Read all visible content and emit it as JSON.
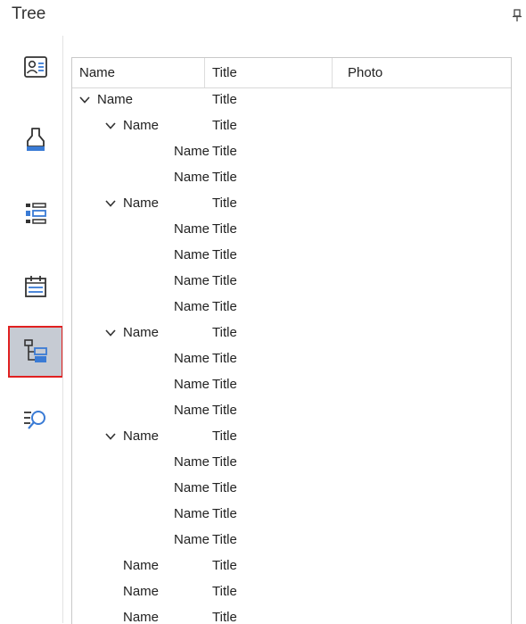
{
  "panel": {
    "title": "Tree"
  },
  "sidebar": {
    "items": [
      {
        "icon": "contact-card-icon",
        "active": false
      },
      {
        "icon": "paint-brush-icon",
        "active": false
      },
      {
        "icon": "list-layout-icon",
        "active": false
      },
      {
        "icon": "calendar-icon",
        "active": false
      },
      {
        "icon": "tree-structure-icon",
        "active": true
      },
      {
        "icon": "search-list-icon",
        "active": false
      }
    ]
  },
  "tree": {
    "columns": [
      "Name",
      "Title",
      "Photo"
    ],
    "rows": [
      {
        "name": "Name",
        "title": "Title",
        "level": 0,
        "expandable": true
      },
      {
        "name": "Name",
        "title": "Title",
        "level": 1,
        "expandable": true
      },
      {
        "name": "Name",
        "title": "Title",
        "level": 2,
        "expandable": false
      },
      {
        "name": "Name",
        "title": "Title",
        "level": 2,
        "expandable": false
      },
      {
        "name": "Name",
        "title": "Title",
        "level": 1,
        "expandable": true
      },
      {
        "name": "Name",
        "title": "Title",
        "level": 2,
        "expandable": false
      },
      {
        "name": "Name",
        "title": "Title",
        "level": 2,
        "expandable": false
      },
      {
        "name": "Name",
        "title": "Title",
        "level": 2,
        "expandable": false
      },
      {
        "name": "Name",
        "title": "Title",
        "level": 2,
        "expandable": false
      },
      {
        "name": "Name",
        "title": "Title",
        "level": 1,
        "expandable": true
      },
      {
        "name": "Name",
        "title": "Title",
        "level": 2,
        "expandable": false
      },
      {
        "name": "Name",
        "title": "Title",
        "level": 2,
        "expandable": false
      },
      {
        "name": "Name",
        "title": "Title",
        "level": 2,
        "expandable": false
      },
      {
        "name": "Name",
        "title": "Title",
        "level": 1,
        "expandable": true
      },
      {
        "name": "Name",
        "title": "Title",
        "level": 2,
        "expandable": false
      },
      {
        "name": "Name",
        "title": "Title",
        "level": 2,
        "expandable": false
      },
      {
        "name": "Name",
        "title": "Title",
        "level": 2,
        "expandable": false
      },
      {
        "name": "Name",
        "title": "Title",
        "level": 2,
        "expandable": false
      },
      {
        "name": "Name",
        "title": "Title",
        "level": 1,
        "expandable": false
      },
      {
        "name": "Name",
        "title": "Title",
        "level": 1,
        "expandable": false
      },
      {
        "name": "Name",
        "title": "Title",
        "level": 1,
        "expandable": false
      }
    ]
  },
  "colors": {
    "accent": "#3a7bd5",
    "active_bg": "#c6cbd3",
    "highlight": "#e02020"
  }
}
